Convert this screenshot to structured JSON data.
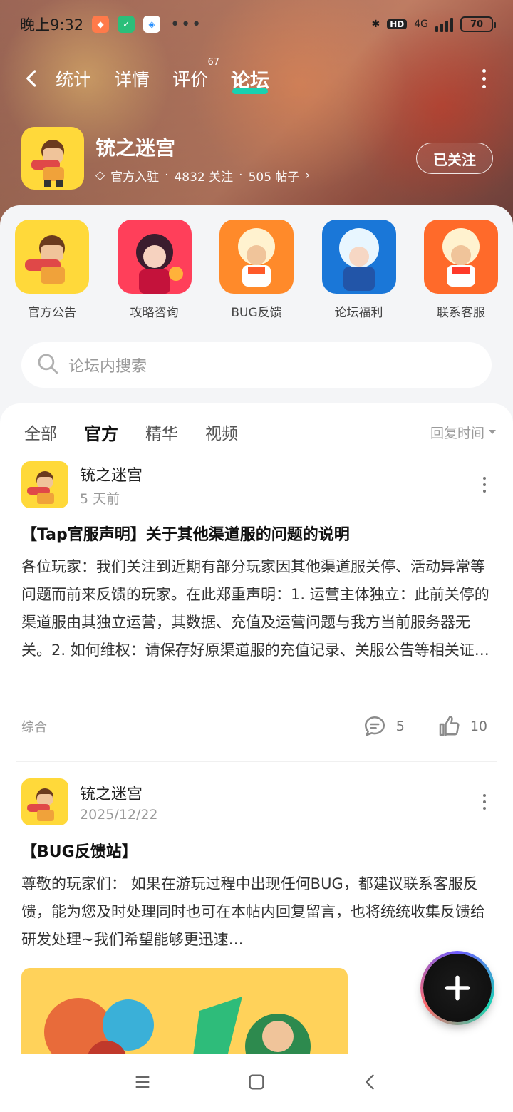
{
  "status": {
    "time": "晚上9:32",
    "network": "4G",
    "battery": "70",
    "hd": "HD"
  },
  "nav": {
    "tabs": [
      {
        "label": "统计"
      },
      {
        "label": "详情"
      },
      {
        "label": "评价",
        "badge": "67"
      },
      {
        "label": "论坛"
      }
    ]
  },
  "game": {
    "title": "铳之迷宫",
    "official": "官方入驻",
    "followers": "4832 关注",
    "posts": "505 帖子",
    "follow_label": "已关注"
  },
  "categories": [
    {
      "label": "官方公告"
    },
    {
      "label": "攻略咨询"
    },
    {
      "label": "BUG反馈"
    },
    {
      "label": "论坛福利"
    },
    {
      "label": "联系客服"
    }
  ],
  "search": {
    "placeholder": "论坛内搜索"
  },
  "feed": {
    "tabs": [
      {
        "label": "全部"
      },
      {
        "label": "官方"
      },
      {
        "label": "精华"
      },
      {
        "label": "视频"
      }
    ],
    "sort_label": "回复时间"
  },
  "posts": [
    {
      "author": "铳之迷宫",
      "time": "5 天前",
      "title": "【Tap官服声明】关于其他渠道服的问题的说明",
      "body": "各位玩家：我们关注到近期有部分玩家因其他渠道服关停、活动异常等问题而前来反馈的玩家。在此郑重声明：1. 运营主体独立：此前关停的渠道服由其独立运营，其数据、充值及运营问题与我方当前服务器无关。2. 如何维权：请保存好原渠道服的充值记录、关服公告等相关证…",
      "tag": "综合",
      "comments": "5",
      "likes": "10"
    },
    {
      "author": "铳之迷宫",
      "time": "2025/12/22",
      "title": "【BUG反馈站】",
      "body": "尊敬的玩家们： 如果在游玩过程中出现任何BUG，都建议联系客服反馈，能为您及时处理同时也可在本帖内回复留言，也将统统收集反馈给研发处理~我们希望能够更迅速…"
    }
  ],
  "icons": {
    "back": "chevron-left-icon",
    "more": "more-vertical-icon",
    "search": "search-icon",
    "comment": "comment-icon",
    "like": "thumbs-up-icon",
    "fab": "plus-icon"
  },
  "colors": {
    "accent": "#19d0b0"
  }
}
